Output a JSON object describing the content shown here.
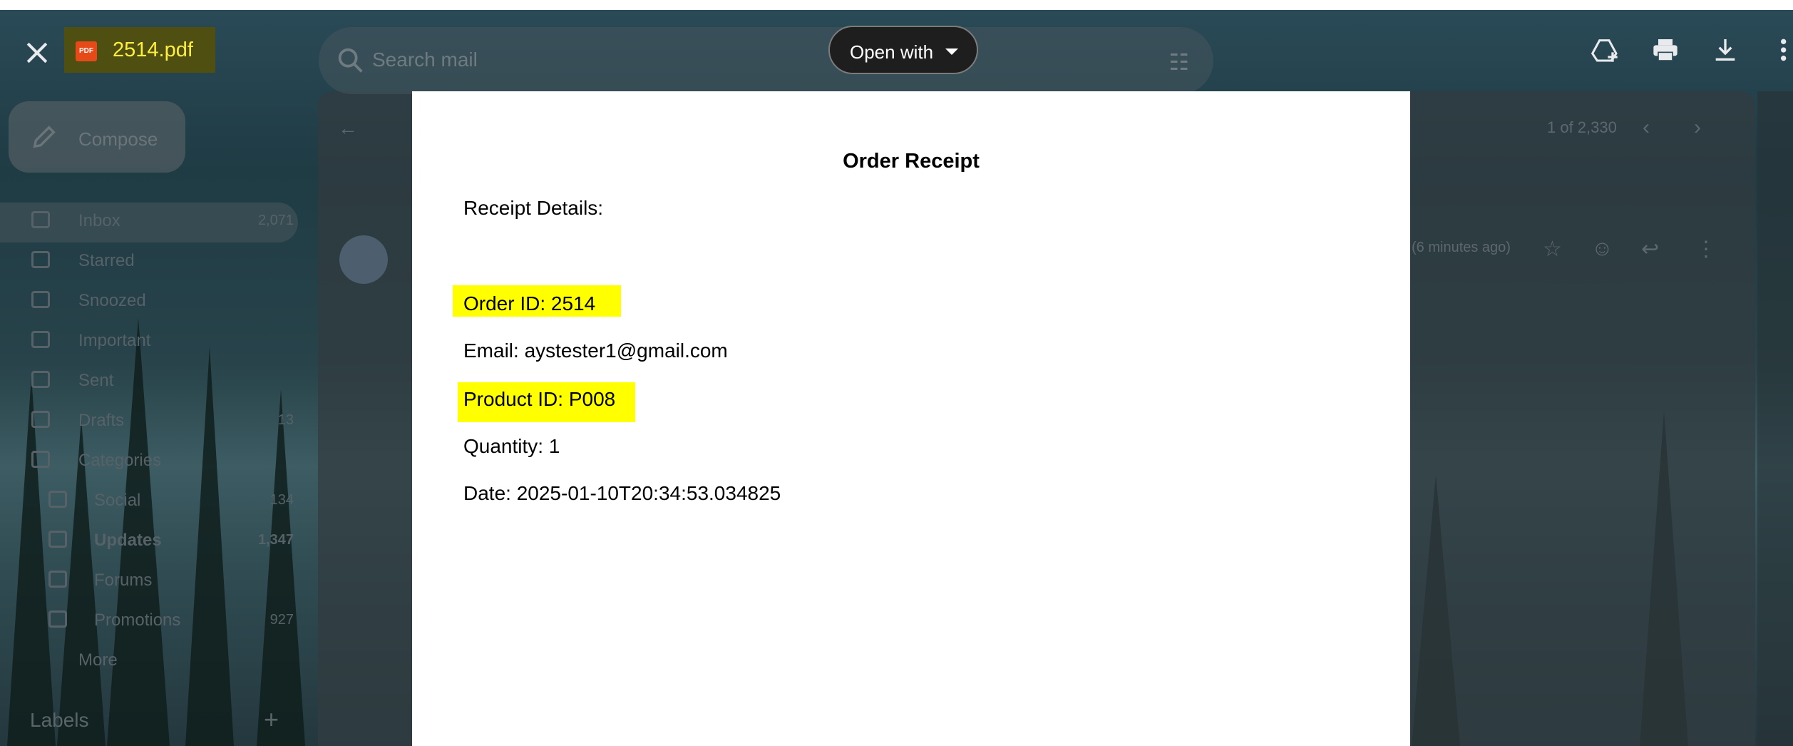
{
  "viewer": {
    "file_name": "2514.pdf",
    "file_type_badge": "PDF",
    "open_with_label": "Open with"
  },
  "document": {
    "title": "Order Receipt",
    "section_label": "Receipt Details:",
    "fields": {
      "order_id": "Order ID: 2514",
      "email": "Email: aystester1@gmail.com",
      "product_id": "Product ID: P008",
      "quantity": "Quantity: 1",
      "date": "Date: 2025-01-10T20:34:53.034825"
    }
  },
  "background_gmail": {
    "search_placeholder": "Search mail",
    "compose_label": "Compose",
    "nav": [
      {
        "label": "Inbox",
        "count": "2,071",
        "icon": "inbox-icon"
      },
      {
        "label": "Starred",
        "count": "",
        "icon": "star-icon"
      },
      {
        "label": "Snoozed",
        "count": "",
        "icon": "clock-icon"
      },
      {
        "label": "Important",
        "count": "",
        "icon": "important-icon"
      },
      {
        "label": "Sent",
        "count": "",
        "icon": "send-icon"
      },
      {
        "label": "Drafts",
        "count": "13",
        "icon": "draft-icon"
      },
      {
        "label": "Categories",
        "count": "",
        "icon": "label-icon"
      },
      {
        "label": "Social",
        "count": "134",
        "icon": "people-icon"
      },
      {
        "label": "Updates",
        "count": "1,347",
        "icon": "info-icon"
      },
      {
        "label": "Forums",
        "count": "",
        "icon": "forum-icon"
      },
      {
        "label": "Promotions",
        "count": "927",
        "icon": "tag-icon"
      },
      {
        "label": "More",
        "count": "",
        "icon": "chevron-down-icon"
      }
    ],
    "labels_heading": "Labels",
    "pagination": "1 of 2,330",
    "time_ago": "(6 minutes ago)"
  },
  "colors": {
    "highlight": "#ffff00",
    "file_name_text": "#ffee3d",
    "overlay_bg": "#2a4a57"
  }
}
